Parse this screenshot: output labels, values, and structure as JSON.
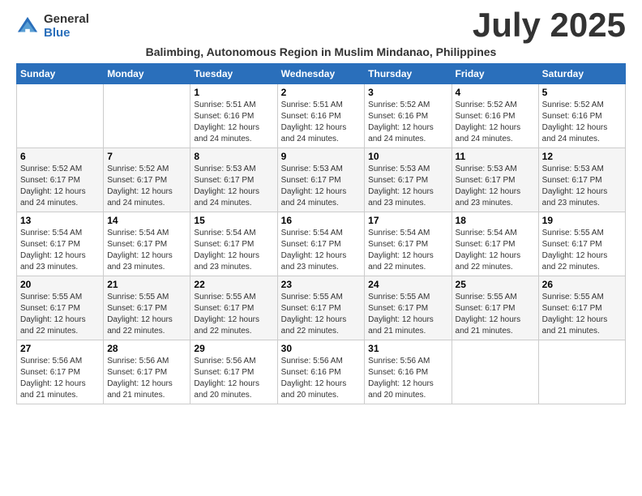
{
  "logo": {
    "general": "General",
    "blue": "Blue"
  },
  "title": "July 2025",
  "subtitle": "Balimbing, Autonomous Region in Muslim Mindanao, Philippines",
  "days_of_week": [
    "Sunday",
    "Monday",
    "Tuesday",
    "Wednesday",
    "Thursday",
    "Friday",
    "Saturday"
  ],
  "weeks": [
    [
      {
        "day": "",
        "info": ""
      },
      {
        "day": "",
        "info": ""
      },
      {
        "day": "1",
        "info": "Sunrise: 5:51 AM\nSunset: 6:16 PM\nDaylight: 12 hours and 24 minutes."
      },
      {
        "day": "2",
        "info": "Sunrise: 5:51 AM\nSunset: 6:16 PM\nDaylight: 12 hours and 24 minutes."
      },
      {
        "day": "3",
        "info": "Sunrise: 5:52 AM\nSunset: 6:16 PM\nDaylight: 12 hours and 24 minutes."
      },
      {
        "day": "4",
        "info": "Sunrise: 5:52 AM\nSunset: 6:16 PM\nDaylight: 12 hours and 24 minutes."
      },
      {
        "day": "5",
        "info": "Sunrise: 5:52 AM\nSunset: 6:16 PM\nDaylight: 12 hours and 24 minutes."
      }
    ],
    [
      {
        "day": "6",
        "info": "Sunrise: 5:52 AM\nSunset: 6:17 PM\nDaylight: 12 hours and 24 minutes."
      },
      {
        "day": "7",
        "info": "Sunrise: 5:52 AM\nSunset: 6:17 PM\nDaylight: 12 hours and 24 minutes."
      },
      {
        "day": "8",
        "info": "Sunrise: 5:53 AM\nSunset: 6:17 PM\nDaylight: 12 hours and 24 minutes."
      },
      {
        "day": "9",
        "info": "Sunrise: 5:53 AM\nSunset: 6:17 PM\nDaylight: 12 hours and 24 minutes."
      },
      {
        "day": "10",
        "info": "Sunrise: 5:53 AM\nSunset: 6:17 PM\nDaylight: 12 hours and 23 minutes."
      },
      {
        "day": "11",
        "info": "Sunrise: 5:53 AM\nSunset: 6:17 PM\nDaylight: 12 hours and 23 minutes."
      },
      {
        "day": "12",
        "info": "Sunrise: 5:53 AM\nSunset: 6:17 PM\nDaylight: 12 hours and 23 minutes."
      }
    ],
    [
      {
        "day": "13",
        "info": "Sunrise: 5:54 AM\nSunset: 6:17 PM\nDaylight: 12 hours and 23 minutes."
      },
      {
        "day": "14",
        "info": "Sunrise: 5:54 AM\nSunset: 6:17 PM\nDaylight: 12 hours and 23 minutes."
      },
      {
        "day": "15",
        "info": "Sunrise: 5:54 AM\nSunset: 6:17 PM\nDaylight: 12 hours and 23 minutes."
      },
      {
        "day": "16",
        "info": "Sunrise: 5:54 AM\nSunset: 6:17 PM\nDaylight: 12 hours and 23 minutes."
      },
      {
        "day": "17",
        "info": "Sunrise: 5:54 AM\nSunset: 6:17 PM\nDaylight: 12 hours and 22 minutes."
      },
      {
        "day": "18",
        "info": "Sunrise: 5:54 AM\nSunset: 6:17 PM\nDaylight: 12 hours and 22 minutes."
      },
      {
        "day": "19",
        "info": "Sunrise: 5:55 AM\nSunset: 6:17 PM\nDaylight: 12 hours and 22 minutes."
      }
    ],
    [
      {
        "day": "20",
        "info": "Sunrise: 5:55 AM\nSunset: 6:17 PM\nDaylight: 12 hours and 22 minutes."
      },
      {
        "day": "21",
        "info": "Sunrise: 5:55 AM\nSunset: 6:17 PM\nDaylight: 12 hours and 22 minutes."
      },
      {
        "day": "22",
        "info": "Sunrise: 5:55 AM\nSunset: 6:17 PM\nDaylight: 12 hours and 22 minutes."
      },
      {
        "day": "23",
        "info": "Sunrise: 5:55 AM\nSunset: 6:17 PM\nDaylight: 12 hours and 22 minutes."
      },
      {
        "day": "24",
        "info": "Sunrise: 5:55 AM\nSunset: 6:17 PM\nDaylight: 12 hours and 21 minutes."
      },
      {
        "day": "25",
        "info": "Sunrise: 5:55 AM\nSunset: 6:17 PM\nDaylight: 12 hours and 21 minutes."
      },
      {
        "day": "26",
        "info": "Sunrise: 5:55 AM\nSunset: 6:17 PM\nDaylight: 12 hours and 21 minutes."
      }
    ],
    [
      {
        "day": "27",
        "info": "Sunrise: 5:56 AM\nSunset: 6:17 PM\nDaylight: 12 hours and 21 minutes."
      },
      {
        "day": "28",
        "info": "Sunrise: 5:56 AM\nSunset: 6:17 PM\nDaylight: 12 hours and 21 minutes."
      },
      {
        "day": "29",
        "info": "Sunrise: 5:56 AM\nSunset: 6:17 PM\nDaylight: 12 hours and 20 minutes."
      },
      {
        "day": "30",
        "info": "Sunrise: 5:56 AM\nSunset: 6:16 PM\nDaylight: 12 hours and 20 minutes."
      },
      {
        "day": "31",
        "info": "Sunrise: 5:56 AM\nSunset: 6:16 PM\nDaylight: 12 hours and 20 minutes."
      },
      {
        "day": "",
        "info": ""
      },
      {
        "day": "",
        "info": ""
      }
    ]
  ]
}
